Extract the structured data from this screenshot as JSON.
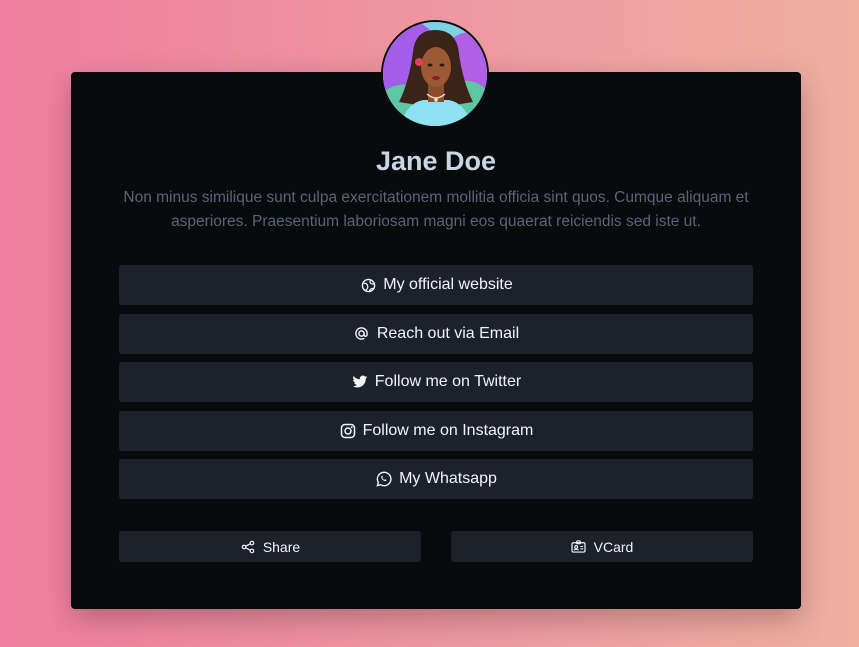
{
  "profile": {
    "name": "Jane Doe",
    "bio": "Non minus similique sunt culpa exercitationem mollitia officia sint quos. Cumque aliquam et asperiores. Praesentium laboriosam magni eos quaerat reiciendis sed iste ut."
  },
  "links": [
    {
      "label": "My official website",
      "icon": "globe-icon"
    },
    {
      "label": "Reach out via Email",
      "icon": "at-icon"
    },
    {
      "label": "Follow me on Twitter",
      "icon": "twitter-icon"
    },
    {
      "label": "Follow me on Instagram",
      "icon": "instagram-icon"
    },
    {
      "label": "My Whatsapp",
      "icon": "whatsapp-icon"
    }
  ],
  "actions": {
    "share_label": "Share",
    "vcard_label": "VCard"
  },
  "colors": {
    "card_background": "#090a0c",
    "button_background": "#1c212b",
    "name_color": "#c9d6e6",
    "bio_color": "#59657a"
  }
}
